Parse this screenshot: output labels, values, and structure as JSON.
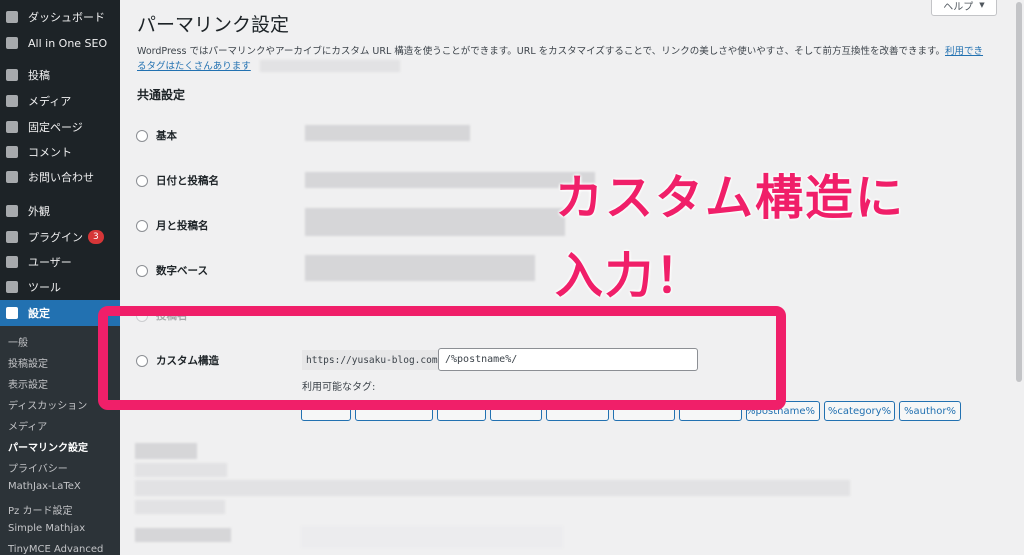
{
  "sidebar": {
    "items": [
      {
        "label": "ダッシュボード",
        "icon": "dashboard-icon"
      },
      {
        "label": "All in One SEO",
        "icon": "gear-icon"
      },
      {
        "label": "投稿",
        "icon": "pin-icon"
      },
      {
        "label": "メディア",
        "icon": "media-icon"
      },
      {
        "label": "固定ページ",
        "icon": "page-icon"
      },
      {
        "label": "コメント",
        "icon": "comment-icon"
      },
      {
        "label": "お問い合わせ",
        "icon": "mail-icon"
      },
      {
        "label": "外観",
        "icon": "brush-icon"
      },
      {
        "label": "プラグイン",
        "icon": "plugin-icon",
        "badge": "3"
      },
      {
        "label": "ユーザー",
        "icon": "user-icon"
      },
      {
        "label": "ツール",
        "icon": "wrench-icon"
      },
      {
        "label": "設定",
        "icon": "settings-icon"
      }
    ],
    "submenu": [
      "一般",
      "投稿設定",
      "表示設定",
      "ディスカッション",
      "メディア",
      "パーマリンク設定",
      "プライバシー",
      "MathJax-LaTeX",
      "Pz カード設定",
      "Simple Mathjax",
      "TinyMCE Advanced"
    ]
  },
  "header": {
    "help_label": "ヘルプ",
    "help_arrow": "▼",
    "title": "パーマリンク設定"
  },
  "intro": {
    "text": "WordPress ではパーマリンクやアーカイブにカスタム URL 構造を使うことができます。URL をカスタマイズすることで、リンクの美しさや使いやすさ、そして前方互換性を改善できます。",
    "link_1": "利用でき",
    "link_2": "るタグはたくさんあります"
  },
  "common": {
    "section_title": "共通設定",
    "options": [
      "基本",
      "日付と投稿名",
      "月と投稿名",
      "数字ベース",
      "投稿名",
      "カスタム構造"
    ]
  },
  "custom": {
    "url_prefix": "https://yusaku-blog.com",
    "value": "/%postname%/",
    "available_tags_label": "利用可能なタグ:",
    "tags": [
      "%postname%",
      "%category%",
      "%author%"
    ]
  },
  "annotation": {
    "line1": "カスタム構造に",
    "line2": "入力！",
    "color": "#f01f69"
  },
  "colors": {
    "sidebar_bg": "#1d2327",
    "active": "#2271b1",
    "page_bg": "#f0f0f1"
  }
}
